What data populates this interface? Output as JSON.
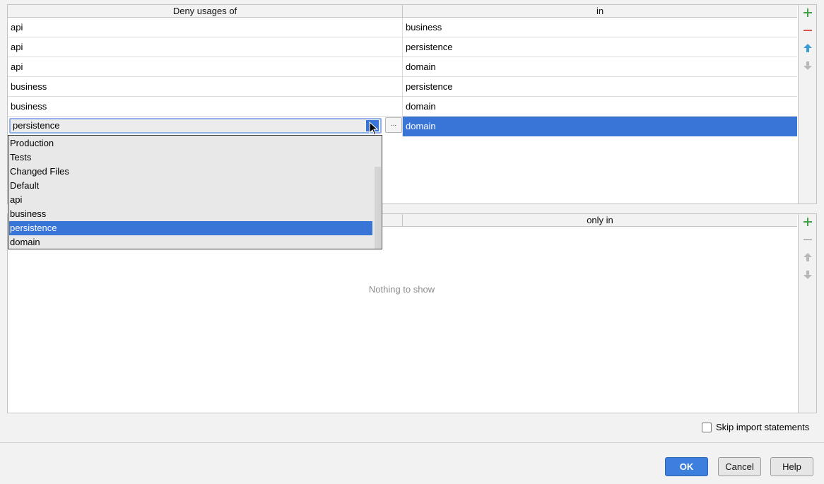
{
  "top_table": {
    "col1_header": "Deny usages of",
    "col2_header": "in",
    "rows": [
      {
        "from": "api",
        "to": "business"
      },
      {
        "from": "api",
        "to": "persistence"
      },
      {
        "from": "api",
        "to": "domain"
      },
      {
        "from": "business",
        "to": "persistence"
      },
      {
        "from": "business",
        "to": "domain"
      },
      {
        "from": "",
        "to": "domain"
      }
    ],
    "editor_value": "persistence",
    "ellipsis_label": "..."
  },
  "dropdown": {
    "items": [
      "Production",
      "Tests",
      "Changed Files",
      "Default",
      "api",
      "business",
      "persistence",
      "domain"
    ],
    "selected": "persistence"
  },
  "bottom_table": {
    "col2_header": "only in",
    "empty_text": "Nothing to show"
  },
  "toolbar": {
    "add": "+",
    "remove": "−",
    "up": "↑",
    "down": "↓"
  },
  "options": {
    "skip_import_label": "Skip import statements",
    "skip_import_checked": false
  },
  "buttons": {
    "ok": "OK",
    "cancel": "Cancel",
    "help": "Help"
  },
  "colors": {
    "selection": "#3875d7",
    "add_green": "#4caf50",
    "remove_red": "#d9534f",
    "arrow_blue": "#3a9bd5",
    "disabled_gray": "#b8b8b8"
  }
}
